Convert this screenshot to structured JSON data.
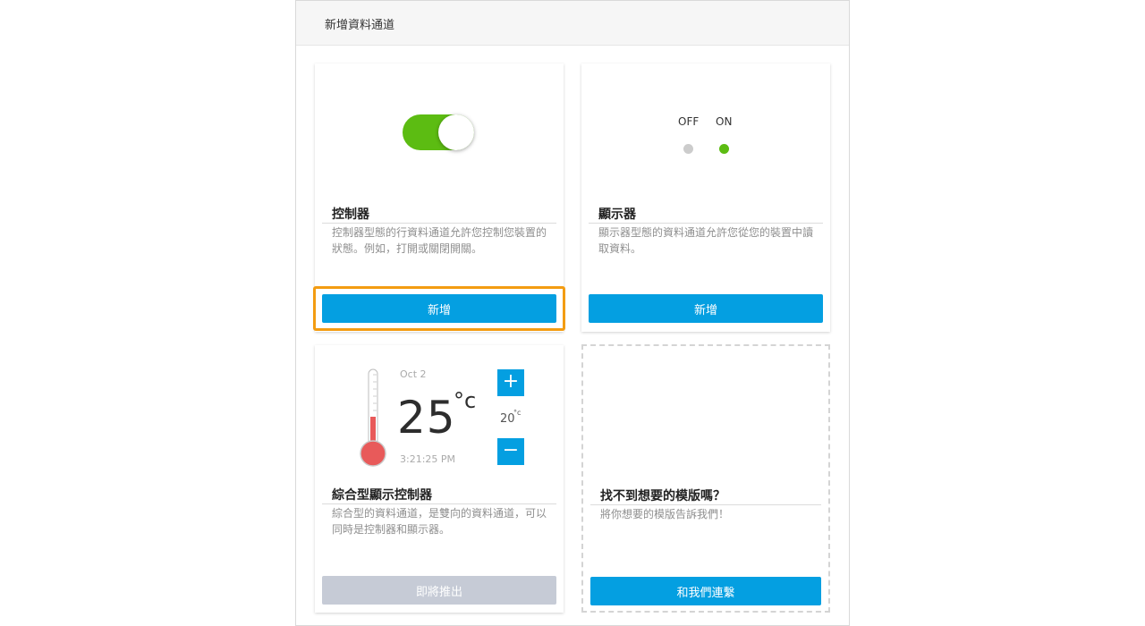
{
  "header": {
    "title": "新增資料通道"
  },
  "cards": {
    "controller": {
      "title": "控制器",
      "description": "控制器型態的行資料通道允許您控制您裝置的狀態。例如，打開或關閉開關。",
      "button": "新增",
      "toggle_state": "on"
    },
    "display": {
      "title": "顯示器",
      "description": "顯示器型態的資料通道允許您從您的裝置中讀取資料。",
      "button": "新增",
      "off_label": "OFF",
      "on_label": "ON"
    },
    "combo": {
      "title": "綜合型顯示控制器",
      "description": "綜合型的資料通道，是雙向的資料通道，可以同時是控制器和顯示器。",
      "button": "即將推出",
      "date": "Oct 2",
      "temperature": "25",
      "unit": "°c",
      "setpoint": "20",
      "setpoint_unit": "°c",
      "time": "3:21:25 PM",
      "plus": "+",
      "minus": "−"
    },
    "template": {
      "title": "找不到想要的模版嗎？",
      "description": "將你想要的模版告訴我們！",
      "button": "和我們連繫"
    }
  },
  "colors": {
    "accent": "#049fe1",
    "toggle_on": "#5cbc12",
    "highlight": "#f39c12",
    "disabled": "#c6cbd6",
    "dot_off": "#cccccc",
    "dot_on": "#5cbc12",
    "thermometer": "#e85a5a"
  }
}
